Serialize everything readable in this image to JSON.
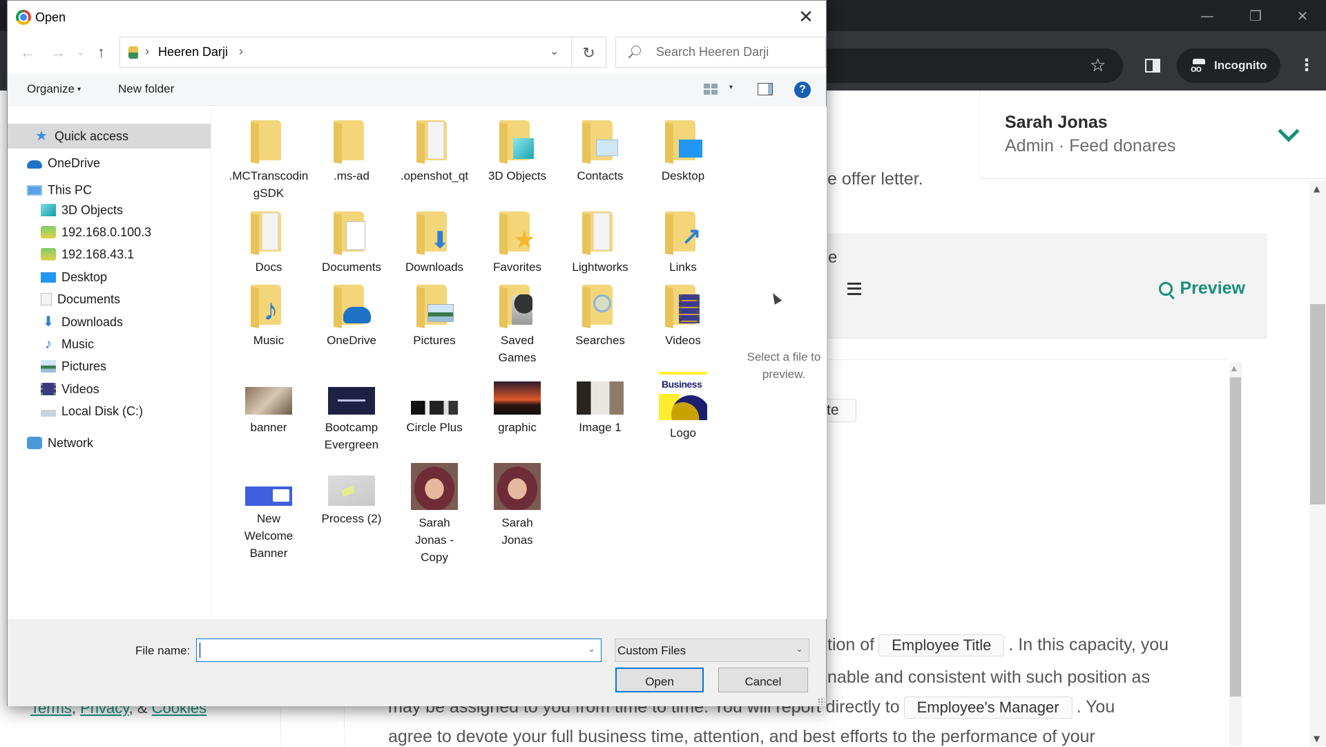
{
  "browser": {
    "window_controls": {
      "minimize": "—",
      "restore": "❐",
      "close": "✕"
    },
    "incognito_label": "Incognito",
    "profile": {
      "name": "Sarah Jonas",
      "role": "Admin · Feed donares"
    },
    "offer_line_fragment": "e offer letter.",
    "editor_heading_fragment": "e",
    "preview_button": "Preview",
    "chip_fragment": "te",
    "document_lines": [
      {
        "before": "tion of",
        "chip": "Employee Title",
        "after": ". In this capacity, you"
      },
      {
        "before": "nable and consistent with such position as",
        "chip": "",
        "after": ""
      },
      {
        "before": "may be assigned to you from time to time. You will report directly to",
        "chip": "Employee's Manager",
        "after": ". You"
      },
      {
        "before": "agree to devote your full business time, attention, and best efforts to the performance of your",
        "chip": "",
        "after": ""
      }
    ],
    "footer": {
      "terms": "Terms",
      "privacy": "Privacy",
      "amp": ", & ",
      "comma": ", ",
      "cookies": "Cookies"
    },
    "accent_color": "#178f7a"
  },
  "dialog": {
    "title": "Open",
    "close_glyph": "✕",
    "nav": {
      "back": "←",
      "forward": "→",
      "recent": "⌄",
      "up": "↑"
    },
    "address": {
      "path": [
        "Heeren Darji"
      ],
      "separator": "›",
      "dropdown_glyph": "⌄"
    },
    "refresh_glyph": "↻",
    "search_placeholder": "Search Heeren Darji",
    "toolbar": {
      "organize": "Organize",
      "new_folder": "New folder",
      "caret": "▾",
      "help": "?"
    },
    "nav_pane": [
      {
        "label": "Quick access",
        "icon": "star-icon",
        "level": 0,
        "selected": true
      },
      {
        "label": "OneDrive",
        "icon": "cloud-icon",
        "level": 0
      },
      {
        "label": "This PC",
        "icon": "computer-icon",
        "level": 0
      },
      {
        "label": "3D Objects",
        "icon": "cube-icon",
        "level": 1
      },
      {
        "label": "192.168.0.100.3",
        "icon": "network-drive-icon",
        "level": 1
      },
      {
        "label": "192.168.43.1",
        "icon": "network-drive-icon",
        "level": 1
      },
      {
        "label": "Desktop",
        "icon": "desktop-icon",
        "level": 1
      },
      {
        "label": "Documents",
        "icon": "document-icon",
        "level": 1
      },
      {
        "label": "Downloads",
        "icon": "download-icon",
        "level": 1
      },
      {
        "label": "Music",
        "icon": "music-icon",
        "level": 1
      },
      {
        "label": "Pictures",
        "icon": "pictures-icon",
        "level": 1
      },
      {
        "label": "Videos",
        "icon": "videos-icon",
        "level": 1
      },
      {
        "label": "Local Disk (C:)",
        "icon": "disk-icon",
        "level": 1
      },
      {
        "label": "Network",
        "icon": "network-icon",
        "level": 0
      }
    ],
    "items": [
      {
        "label": ".MCTranscodingSDK",
        "type": "folder"
      },
      {
        "label": ".ms-ad",
        "type": "folder"
      },
      {
        "label": ".openshot_qt",
        "type": "folder"
      },
      {
        "label": "3D Objects",
        "type": "folder"
      },
      {
        "label": "Contacts",
        "type": "folder"
      },
      {
        "label": "Desktop",
        "type": "folder"
      },
      {
        "label": "Docs",
        "type": "folder"
      },
      {
        "label": "Documents",
        "type": "folder"
      },
      {
        "label": "Downloads",
        "type": "folder"
      },
      {
        "label": "Favorites",
        "type": "folder"
      },
      {
        "label": "Lightworks",
        "type": "folder"
      },
      {
        "label": "Links",
        "type": "folder"
      },
      {
        "label": "Music",
        "type": "folder"
      },
      {
        "label": "OneDrive",
        "type": "folder"
      },
      {
        "label": "Pictures",
        "type": "folder"
      },
      {
        "label": "Saved Games",
        "type": "folder"
      },
      {
        "label": "Searches",
        "type": "folder"
      },
      {
        "label": "Videos",
        "type": "folder"
      },
      {
        "label": "banner",
        "type": "image"
      },
      {
        "label": "Bootcamp Evergreen",
        "type": "image"
      },
      {
        "label": "Circle Plus",
        "type": "image"
      },
      {
        "label": "graphic",
        "type": "image"
      },
      {
        "label": "Image 1",
        "type": "image"
      },
      {
        "label": "Logo",
        "type": "image",
        "thumb_text": "Business"
      },
      {
        "label": "New Welcome Banner",
        "type": "image"
      },
      {
        "label": "Process (2)",
        "type": "image"
      },
      {
        "label": "Sarah Jonas - Copy",
        "type": "image"
      },
      {
        "label": "Sarah Jonas",
        "type": "image"
      }
    ],
    "preview_message": "Select a file to preview.",
    "file_name_label": "File name:",
    "file_name_value": "",
    "file_type": "Custom Files",
    "dropdown_glyph": "⌄",
    "open_button": "Open",
    "cancel_button": "Cancel"
  }
}
